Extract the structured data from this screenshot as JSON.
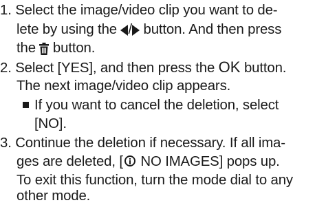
{
  "steps": [
    {
      "number": "1.",
      "line1": "Select the image/video clip you want to de-",
      "line2_a": "lete by using the ",
      "line2_sep": "/",
      "line2_b": " button. And then press",
      "line3_a": "the ",
      "line3_b": " button.",
      "icons": [
        "left-arrow-icon",
        "right-arrow-icon",
        "trash-icon"
      ]
    },
    {
      "number": "2.",
      "line1_a": "Select [YES], and then press the ",
      "line1_ok": "OK",
      "line1_b": " button.",
      "line2": "The next image/video clip appears.",
      "note_line1": "If you want to cancel the deletion, select",
      "note_line2": "[NO]."
    },
    {
      "number": "3.",
      "line1": "Continue the deletion if necessary. If all ima-",
      "line2_a": "ges are deleted, [",
      "line2_b": " NO IMAGES] pops up.",
      "line3": "To exit this function, turn the mode dial to any",
      "line4": "other mode.",
      "icons": [
        "info-icon"
      ]
    }
  ],
  "colors": {
    "text": "#1a1a1a",
    "background": "#ffffff"
  }
}
